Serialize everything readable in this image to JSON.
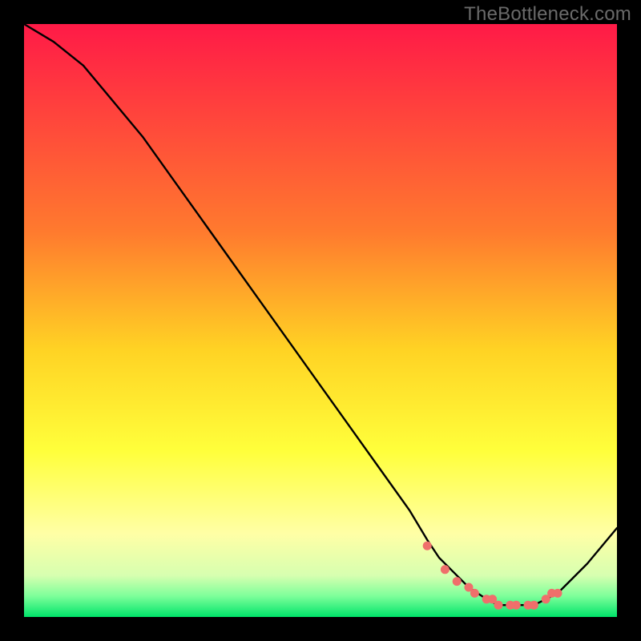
{
  "watermark": "TheBottleneck.com",
  "colors": {
    "red": "#ff1a47",
    "orange": "#ffb324",
    "yellow": "#ffff3b",
    "pale_yellow": "#ffffa6",
    "green": "#00e46a",
    "curve": "#000000",
    "dot": "#ef6f6b",
    "background": "#000000",
    "watermark_text": "#6a6a6a"
  },
  "chart_data": {
    "type": "line",
    "title": "",
    "xlabel": "",
    "ylabel": "",
    "xlim": [
      0,
      100
    ],
    "ylim": [
      0,
      100
    ],
    "grid": false,
    "legend": false,
    "series": [
      {
        "name": "bottleneck-curve",
        "x": [
          0,
          5,
          10,
          15,
          20,
          25,
          30,
          35,
          40,
          45,
          50,
          55,
          60,
          65,
          68,
          70,
          72,
          75,
          78,
          80,
          82,
          84,
          86,
          88,
          90,
          92,
          95,
          100
        ],
        "y": [
          100,
          97,
          93,
          87,
          81,
          74,
          67,
          60,
          53,
          46,
          39,
          32,
          25,
          18,
          13,
          10,
          8,
          5,
          3,
          2,
          2,
          2,
          2,
          3,
          4,
          6,
          9,
          15
        ]
      }
    ],
    "dots": {
      "name": "sample-points",
      "x": [
        68,
        71,
        73,
        75,
        76,
        78,
        79,
        80,
        82,
        83,
        85,
        86,
        88,
        89,
        90
      ],
      "y": [
        12,
        8,
        6,
        5,
        4,
        3,
        3,
        2,
        2,
        2,
        2,
        2,
        3,
        4,
        4
      ]
    },
    "gradient_stops": [
      {
        "offset": 0.0,
        "color": "#ff1a47"
      },
      {
        "offset": 0.35,
        "color": "#ff7a2e"
      },
      {
        "offset": 0.55,
        "color": "#ffd324"
      },
      {
        "offset": 0.72,
        "color": "#ffff3b"
      },
      {
        "offset": 0.86,
        "color": "#ffffa6"
      },
      {
        "offset": 0.93,
        "color": "#d7ffb0"
      },
      {
        "offset": 0.965,
        "color": "#7dff9a"
      },
      {
        "offset": 1.0,
        "color": "#00e46a"
      }
    ]
  }
}
